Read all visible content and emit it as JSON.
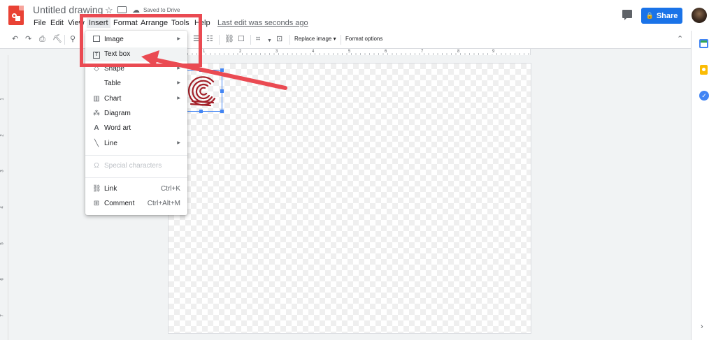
{
  "header": {
    "doc_title": "Untitled drawing",
    "save_status": "Saved to Drive",
    "last_edit": "Last edit was seconds ago",
    "share_label": "Share"
  },
  "menubar": {
    "items": [
      {
        "label": "File"
      },
      {
        "label": "Edit"
      },
      {
        "label": "View"
      },
      {
        "label": "Insert"
      },
      {
        "label": "Format"
      },
      {
        "label": "Arrange"
      },
      {
        "label": "Tools"
      },
      {
        "label": "Help"
      }
    ],
    "active": "Insert"
  },
  "toolbar": {
    "replace_image": "Replace image ▾",
    "format_options": "Format options"
  },
  "ruler": {
    "top_numbers": [
      "1",
      "2",
      "3",
      "4",
      "5",
      "6",
      "7",
      "8",
      "9"
    ],
    "left_numbers": [
      "1",
      "2",
      "3",
      "4",
      "5",
      "6",
      "7"
    ]
  },
  "insert_menu": {
    "items": [
      {
        "label": "Image",
        "icon": "image-icon",
        "submenu": true
      },
      {
        "label": "Text box",
        "icon": "text-box-icon",
        "highlighted": true
      },
      {
        "label": "Shape",
        "icon": "shape-icon",
        "submenu": true
      },
      {
        "label": "Table",
        "icon": "",
        "submenu": true
      },
      {
        "label": "Chart",
        "icon": "chart-icon",
        "submenu": true
      },
      {
        "label": "Diagram",
        "icon": "diagram-icon"
      },
      {
        "label": "Word art",
        "icon": "word-art-icon"
      },
      {
        "label": "Line",
        "icon": "line-icon",
        "submenu": true
      },
      {
        "label": "Special characters",
        "icon": "omega-icon",
        "disabled": true
      },
      {
        "label": "Link",
        "icon": "link-icon",
        "shortcut": "Ctrl+K"
      },
      {
        "label": "Comment",
        "icon": "comment-icon",
        "shortcut": "Ctrl+Alt+M"
      }
    ]
  },
  "colors": {
    "share_blue": "#1a73e8",
    "annotation_red": "#ea4a52",
    "selection_blue": "#4285f4",
    "logo_red": "#e94235",
    "fingerprint_red": "#a31f28"
  }
}
